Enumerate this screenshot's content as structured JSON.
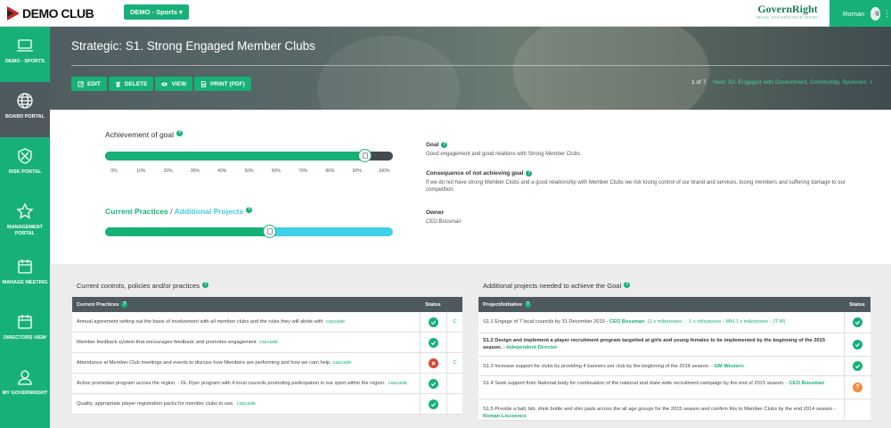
{
  "topbar": {
    "logo_text": "DEMO CLUB",
    "org_select": "DEMO - Sports",
    "brand_name": "GovernRight",
    "brand_tag": "MAKE GOVERNANCE WORK",
    "user_name": "Roman"
  },
  "sidebar": {
    "items": [
      {
        "label": "DEMO - SPORTS",
        "icon": "laptop-icon"
      },
      {
        "label": "BOARD PORTAL",
        "icon": "globe-icon"
      },
      {
        "label": "RISK PORTAL",
        "icon": "shield-icon"
      },
      {
        "label": "MANAGEMENT PORTAL",
        "icon": "star-icon"
      },
      {
        "label": "MANAGE MEETING",
        "icon": "calendar-icon"
      },
      {
        "label": "DIRECTORS VIEW",
        "icon": "calendar-icon"
      },
      {
        "label": "MY GOVERNRIGHT",
        "icon": "user-icon"
      }
    ]
  },
  "hero": {
    "title": "Strategic: S1. Strong Engaged Member Clubs",
    "actions": [
      {
        "label": "EDIT",
        "icon": "edit-icon"
      },
      {
        "label": "DELETE",
        "icon": "trash-icon"
      },
      {
        "label": "VIEW",
        "icon": "eye-icon"
      },
      {
        "label": "PRINT (PDF)",
        "icon": "document-icon"
      }
    ],
    "pager_count": "1 of 7",
    "pager_next": "Next: S2. Engaged with Government, Community, Sponsors"
  },
  "goal": {
    "achievement_label": "Achievement of goal",
    "achievement_fraction": 0.9,
    "ticks": [
      "0%",
      "10%",
      "20%",
      "30%",
      "40%",
      "50%",
      "60%",
      "70%",
      "80%",
      "90%",
      "100%"
    ],
    "current_practices_label": "Current Practices",
    "separator": "/",
    "additional_projects_label": "Additional Projects",
    "practices_fraction": 0.57,
    "goal_head": "Goal",
    "goal_text": "Good engagement and good relations with Strong Member Clubs",
    "consequence_head": "Consequence of not achieving goal",
    "consequence_text": "If we do not have strong Member Clubs and a good relationship with Member Clubs we risk losing control of our brand and services, losing members and suffering damage to our competition",
    "owner_head": "Owner",
    "owner_text": "CEO Bossman"
  },
  "controls": {
    "title": "Current controls, policies and/or practices",
    "col_practices": "Current Practices",
    "col_status": "Status",
    "rows": [
      {
        "text": "Annual agreement setting out the basis of involvement with all member clubs and the rules they will abide with",
        "link": "cascade",
        "status": "ok",
        "extra": "C"
      },
      {
        "text": "Member feedback system that encourages feedback and promotes engagement",
        "link": "cascade",
        "status": "ok",
        "extra": ""
      },
      {
        "text": "Attendance at Member Club meetings and events to discuss how Members are performing and how we cam help",
        "link": "cascade",
        "status": "bad",
        "extra": "C"
      },
      {
        "text": "Active promotion program across the region. - DL Flyer program with 4 local councils promoting participation in our sport within the region.",
        "link": "cascade",
        "status": "ok",
        "extra": ""
      },
      {
        "text": "Quality, appropriate player registration packs for member clubs to use.",
        "link": "cascade",
        "status": "ok",
        "extra": ""
      }
    ]
  },
  "projects": {
    "title": "Additional projects needed to achieve the Goal",
    "col_project": "Project/Initiative",
    "col_status": "Status",
    "rows": [
      {
        "text": "S1.1 Engage of 7 local councils by 31 December 2015 -",
        "owner": "CEO Bossman",
        "extra": "(1 x milestones - : 1 x milestones - MM,1 x milestones - JT-M)",
        "status": "ok",
        "bold": false
      },
      {
        "text": "S1.2 Design and implement a player recruitment program targetted at girls and young females to be implemented by the beginning of the 2015 season. -",
        "owner": "Independent Director",
        "extra": "",
        "status": "ok",
        "bold": true
      },
      {
        "text": "S1.3 Increase support for clubs by providing 4 banners per club by the beginning of the 2016 season. -",
        "owner": "GM Western",
        "extra": "",
        "status": "ok",
        "bold": false
      },
      {
        "text": "S1.4 Seek support from National body for continuation of the national and state wide recruitment campaign by the end of 2015 season. -",
        "owner": "CEO Bossman",
        "extra": "",
        "status": "warn",
        "bold": false
      },
      {
        "text": "S1.5 Provide a ball, bib, drink bottle and shin pads across the all age groups for the 2015 season and confirm this to Member Clubs by the end 2014 season -",
        "owner": "Roman Lisceenco",
        "extra": "",
        "status": "",
        "bold": false
      }
    ]
  },
  "colors": {
    "accent": "#17b177",
    "header": "#4e5a60",
    "secondary": "#40d1e8",
    "danger": "#d9442f",
    "warning": "#f28c43"
  }
}
